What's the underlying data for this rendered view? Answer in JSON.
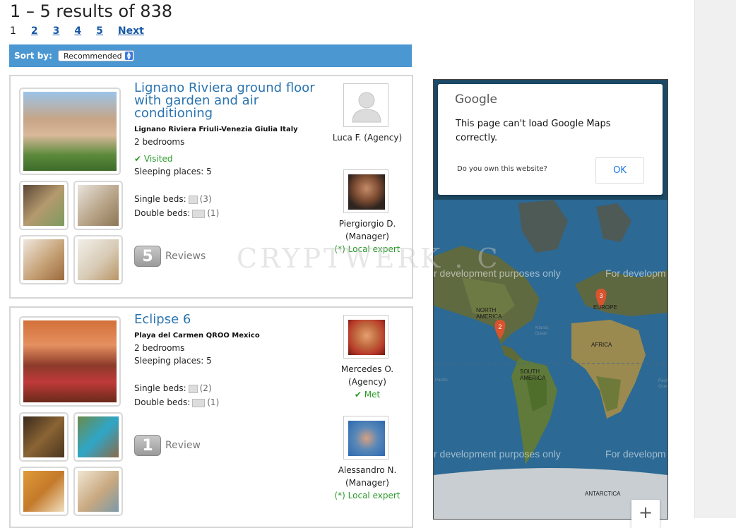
{
  "results": {
    "summary": "1 – 5 results of 838"
  },
  "pagination": {
    "current": "1",
    "pages": [
      "2",
      "3",
      "4",
      "5"
    ],
    "next": "Next"
  },
  "sort": {
    "label": "Sort by:",
    "selected": "Recommended"
  },
  "listings": [
    {
      "title": "Lignano Riviera ground floor with garden and air conditioning",
      "location": "Lignano Riviera Friuli-Venezia Giulia Italy",
      "bedrooms": "2 bedrooms",
      "visited": "Visited",
      "sleeping": "Sleeping places: 5",
      "single_beds_label": "Single beds:",
      "single_beds": "(3)",
      "double_beds_label": "Double beds:",
      "double_beds": "(1)",
      "reviews_count": "5",
      "reviews_label": "Reviews",
      "people": [
        {
          "name": "Luca F. (Agency)"
        },
        {
          "name": "Piergiorgio D.",
          "role": "(Manager)",
          "tag": "(*) Local expert"
        }
      ]
    },
    {
      "title": "Eclipse 6",
      "location": "Playa del Carmen QROO Mexico",
      "bedrooms": "2 bedrooms",
      "sleeping": "Sleeping places: 5",
      "single_beds_label": "Single beds:",
      "single_beds": "(2)",
      "double_beds_label": "Double beds:",
      "double_beds": "(1)",
      "reviews_count": "1",
      "reviews_label": "Review",
      "people": [
        {
          "name": "Mercedes O.",
          "role": "(Agency)",
          "tag": "Met"
        },
        {
          "name": "Alessandro N.",
          "role": "(Manager)",
          "tag": "(*) Local expert"
        }
      ]
    }
  ],
  "map": {
    "dialog": {
      "brand": "Google",
      "message": "This page can't load Google Maps correctly.",
      "question": "Do you own this website?",
      "ok": "OK"
    },
    "dev_text": "For development purposes only",
    "dev_text_cut": "r development purposes only",
    "dev_text_short": "For developm",
    "labels": {
      "north_america": "NORTH AMERICA",
      "europe": "EUROPE",
      "africa": "AFRICA",
      "south_america": "SOUTH AMERICA",
      "antarctica": "ANTARCTICA",
      "atlantic": "Atlantic Ocean",
      "pacific": "Pacific",
      "pacific_right": "Pacific Ocean"
    },
    "markers": [
      "2",
      "3"
    ],
    "zoom_in": "+"
  },
  "watermark": "CRYPTWERK . C"
}
